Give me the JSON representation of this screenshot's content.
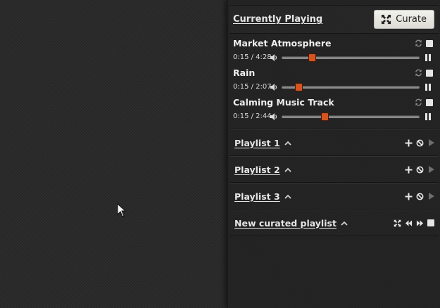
{
  "header": {
    "title": "Currently Playing",
    "curate_label": "Curate"
  },
  "tracks": [
    {
      "name": "Market Atmosphere",
      "time": "0:15 / 4:28",
      "position": 0.22
    },
    {
      "name": "Rain",
      "time": "0:15 / 2:07",
      "position": 0.12
    },
    {
      "name": "Calming Music Track",
      "time": "0:15 / 2:44",
      "position": 0.31
    }
  ],
  "playlists": [
    {
      "title": "Playlist 1"
    },
    {
      "title": "Playlist 2"
    },
    {
      "title": "Playlist 3"
    }
  ],
  "curated": {
    "title": "New curated playlist"
  },
  "icons": {
    "curate": "shuffle-arrows-icon",
    "loop": "loop-icon",
    "stop": "stop-icon",
    "volume": "volume-icon",
    "pause": "pause-icon",
    "add": "plus-icon",
    "block": "block-icon",
    "play": "play-icon",
    "rewind": "rewind-icon",
    "fast_forward": "fast-forward-icon"
  },
  "colors": {
    "accent": "#d6541f",
    "panel": "#222222",
    "background": "#2a2a2a"
  }
}
